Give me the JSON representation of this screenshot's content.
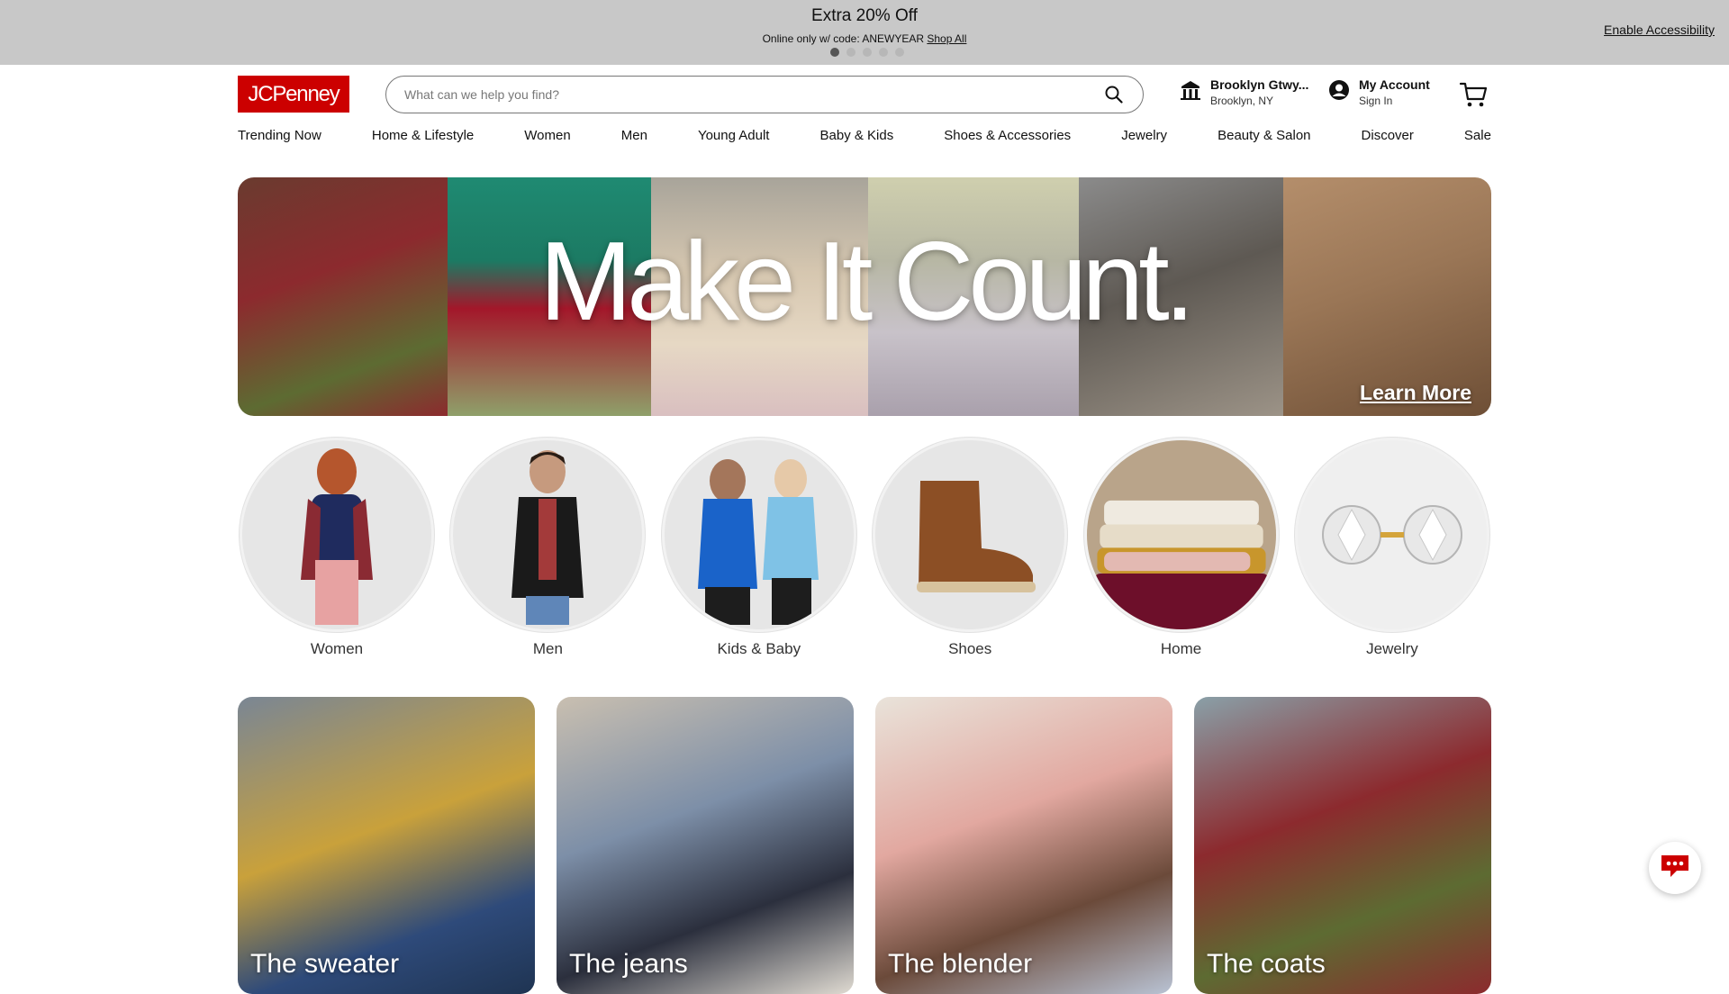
{
  "promo": {
    "title": "Extra 20% Off",
    "subtitle": "Online only w/ code: ANEWYEAR",
    "link": "Shop All",
    "accessibility": "Enable Accessibility"
  },
  "header": {
    "logo": "JCPenney",
    "search_placeholder": "What can we help you find?",
    "store_name": "Brooklyn Gtwy...",
    "store_location": "Brooklyn, NY",
    "account_title": "My Account",
    "account_sub": "Sign In"
  },
  "nav": [
    "Trending Now",
    "Home & Lifestyle",
    "Women",
    "Men",
    "Young Adult",
    "Baby & Kids",
    "Shoes & Accessories",
    "Jewelry",
    "Beauty & Salon",
    "Discover",
    "Sale"
  ],
  "hero": {
    "title": "Make It Count.",
    "cta": "Learn More"
  },
  "categories": [
    "Women",
    "Men",
    "Kids & Baby",
    "Shoes",
    "Home",
    "Jewelry"
  ],
  "cards": [
    "The sweater",
    "The jeans",
    "The blender",
    "The coats"
  ],
  "colors": {
    "brand": "#cc0000",
    "promo_bg": "#c8c8c8"
  }
}
